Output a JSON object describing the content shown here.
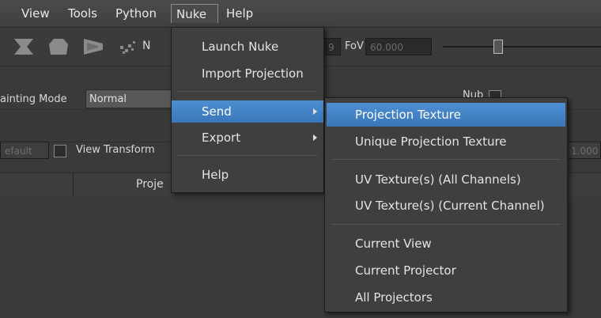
{
  "menubar": {
    "items": [
      {
        "label": "View"
      },
      {
        "label": "Tools"
      },
      {
        "label": "Python"
      },
      {
        "label": "Nuke"
      },
      {
        "label": "Help"
      }
    ]
  },
  "toolbar": {
    "partial_label": "N",
    "field_left_value": "9",
    "fov_label": "FoV",
    "fov_value": "60.000",
    "slider_level": 0.35
  },
  "painting": {
    "mode_label": "ainting Mode",
    "mode_value": "Normal",
    "partial_right_label": "Nub"
  },
  "viewrow": {
    "default_value": "efault",
    "view_transform_label": "View Transform",
    "right_value": "1.000"
  },
  "header": {
    "column_partial": "Proje"
  },
  "nuke_menu": {
    "items": [
      {
        "label": "Launch Nuke"
      },
      {
        "label": "Import Projection"
      },
      {
        "label": "Send"
      },
      {
        "label": "Export"
      },
      {
        "label": "Help"
      }
    ]
  },
  "send_menu": {
    "items": [
      {
        "label": "Projection Texture"
      },
      {
        "label": "Unique Projection Texture"
      },
      {
        "label": "UV Texture(s) (All Channels)"
      },
      {
        "label": "UV Texture(s) (Current Channel)"
      },
      {
        "label": "Current View"
      },
      {
        "label": "Current Projector"
      },
      {
        "label": "All Projectors"
      }
    ]
  },
  "colors": {
    "highlight": "#3f7fc2",
    "background": "#3a3a3a",
    "menu_bg": "#3f3f3f"
  }
}
